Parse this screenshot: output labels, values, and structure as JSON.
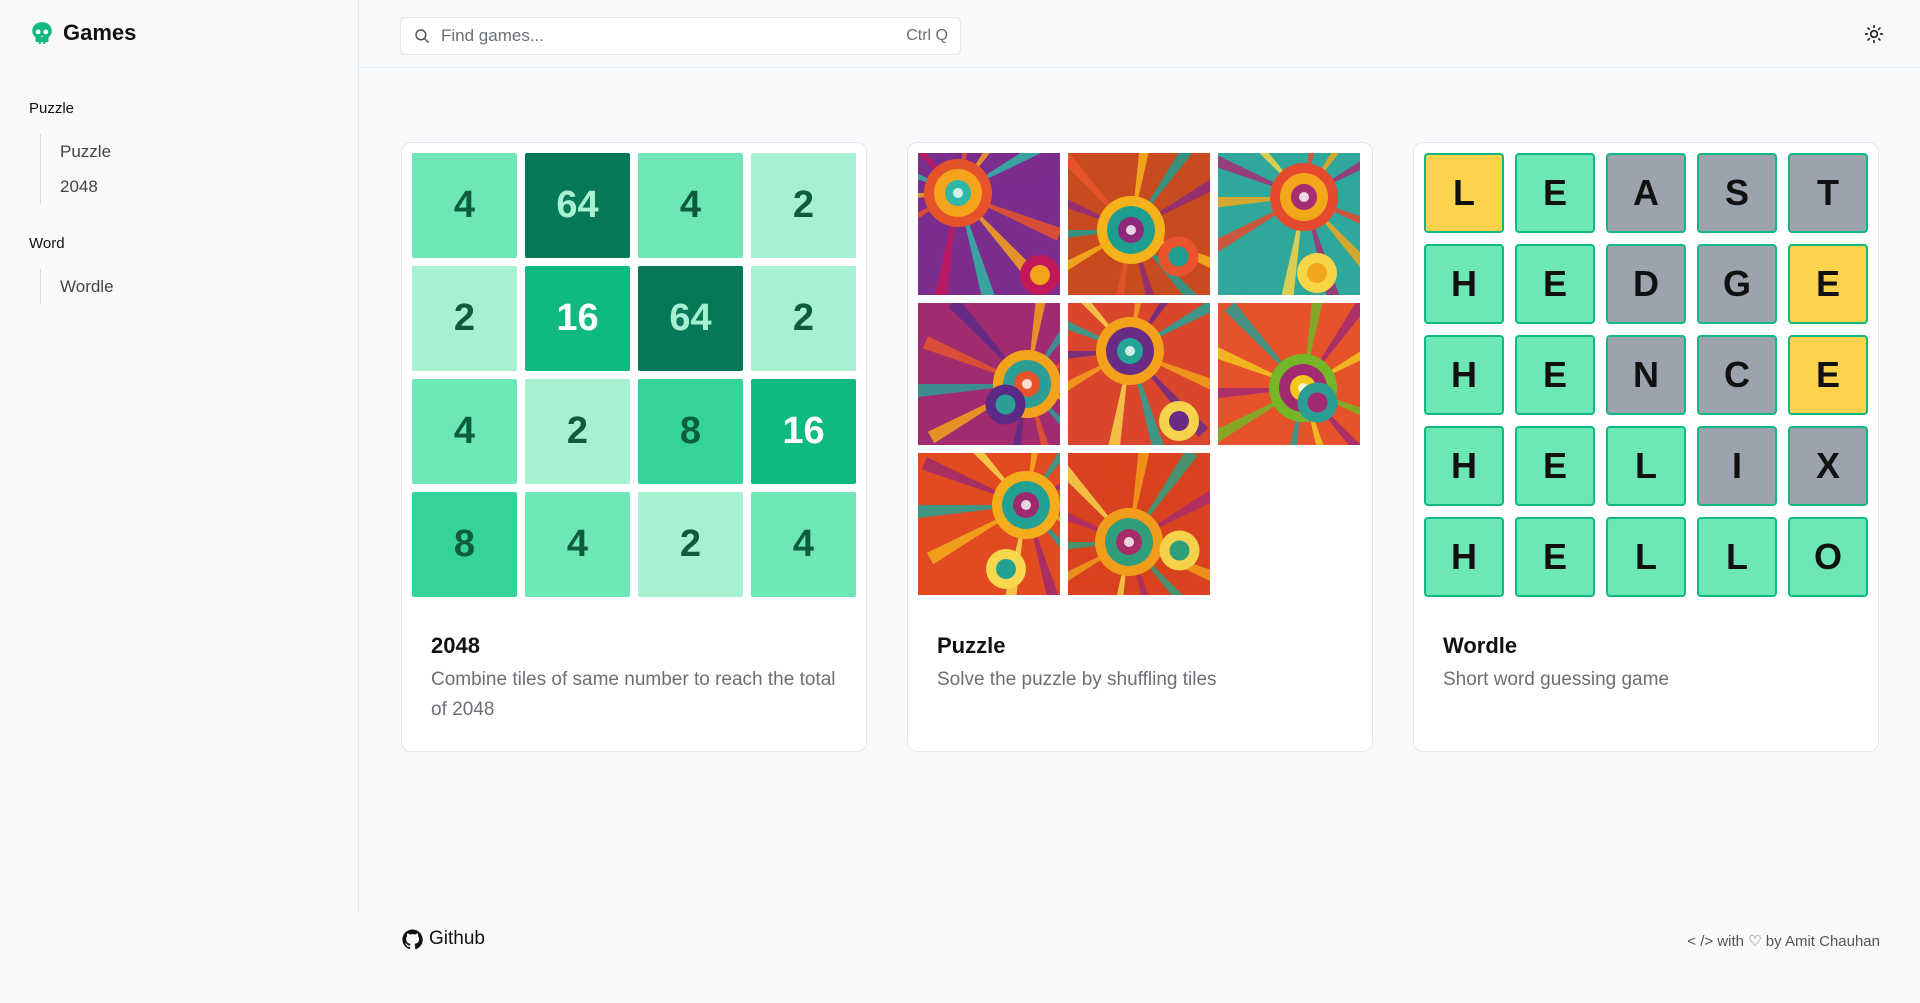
{
  "brand": {
    "name": "Games",
    "logo": "skull-icon",
    "color": "#10b981"
  },
  "sidebar": {
    "groups": [
      {
        "title": "Puzzle",
        "items": [
          {
            "label": "Puzzle"
          },
          {
            "label": "2048"
          }
        ]
      },
      {
        "title": "Word",
        "items": [
          {
            "label": "Wordle"
          }
        ]
      }
    ]
  },
  "header": {
    "search": {
      "placeholder": "Find games...",
      "shortcut": "Ctrl Q",
      "icon": "search-icon"
    },
    "theme_toggle_icon": "sun-icon"
  },
  "cards": [
    {
      "title": "2048",
      "description": "Combine tiles of same number to reach the total of 2048",
      "grid": [
        [
          "4",
          "64",
          "4",
          "2"
        ],
        [
          "2",
          "16",
          "64",
          "2"
        ],
        [
          "4",
          "2",
          "8",
          "16"
        ],
        [
          "8",
          "4",
          "2",
          "4"
        ]
      ]
    },
    {
      "title": "Puzzle",
      "description": "Solve the puzzle by shuffling tiles",
      "tile_count": 8
    },
    {
      "title": "Wordle",
      "description": "Short word guessing game",
      "rows": [
        {
          "letters": [
            "L",
            "E",
            "A",
            "S",
            "T"
          ],
          "states": [
            "present",
            "correct",
            "absent",
            "absent",
            "absent"
          ]
        },
        {
          "letters": [
            "H",
            "E",
            "D",
            "G",
            "E"
          ],
          "states": [
            "correct",
            "correct",
            "absent",
            "absent",
            "present"
          ]
        },
        {
          "letters": [
            "H",
            "E",
            "N",
            "C",
            "E"
          ],
          "states": [
            "correct",
            "correct",
            "absent",
            "absent",
            "present"
          ]
        },
        {
          "letters": [
            "H",
            "E",
            "L",
            "I",
            "X"
          ],
          "states": [
            "correct",
            "correct",
            "correct",
            "absent",
            "absent"
          ]
        },
        {
          "letters": [
            "H",
            "E",
            "L",
            "L",
            "O"
          ],
          "states": [
            "correct",
            "correct",
            "correct",
            "correct",
            "correct"
          ]
        }
      ]
    }
  ],
  "footer": {
    "github_label": "Github",
    "credit": "< /> with ♡ by Amit Chauhan"
  }
}
